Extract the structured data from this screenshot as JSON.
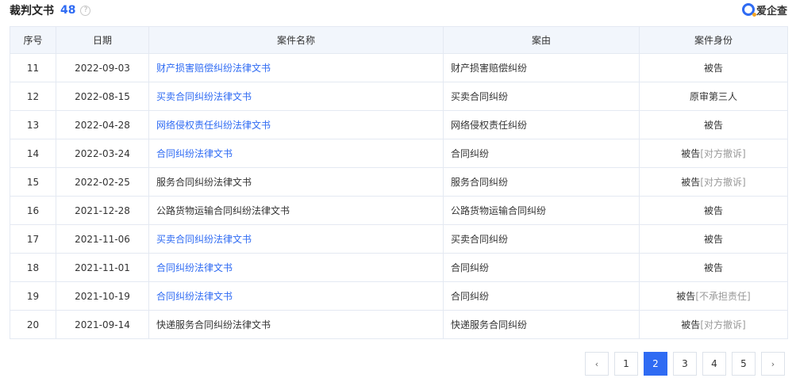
{
  "header": {
    "title": "裁判文书",
    "count": "48",
    "help": "?",
    "brand": "爱企查"
  },
  "table": {
    "columns": [
      "序号",
      "日期",
      "案件名称",
      "案由",
      "案件身份"
    ],
    "rows": [
      {
        "no": "11",
        "date": "2022-09-03",
        "name": "财产损害赔偿纠纷法律文书",
        "link": true,
        "cause": "财产损害赔偿纠纷",
        "role": "被告",
        "role_note": ""
      },
      {
        "no": "12",
        "date": "2022-08-15",
        "name": "买卖合同纠纷法律文书",
        "link": true,
        "cause": "买卖合同纠纷",
        "role": "原审第三人",
        "role_note": ""
      },
      {
        "no": "13",
        "date": "2022-04-28",
        "name": "网络侵权责任纠纷法律文书",
        "link": true,
        "cause": "网络侵权责任纠纷",
        "role": "被告",
        "role_note": ""
      },
      {
        "no": "14",
        "date": "2022-03-24",
        "name": "合同纠纷法律文书",
        "link": true,
        "cause": "合同纠纷",
        "role": "被告",
        "role_note": "[对方撤诉]"
      },
      {
        "no": "15",
        "date": "2022-02-25",
        "name": "服务合同纠纷法律文书",
        "link": false,
        "cause": "服务合同纠纷",
        "role": "被告",
        "role_note": "[对方撤诉]"
      },
      {
        "no": "16",
        "date": "2021-12-28",
        "name": "公路货物运输合同纠纷法律文书",
        "link": false,
        "cause": "公路货物运输合同纠纷",
        "role": "被告",
        "role_note": ""
      },
      {
        "no": "17",
        "date": "2021-11-06",
        "name": "买卖合同纠纷法律文书",
        "link": true,
        "cause": "买卖合同纠纷",
        "role": "被告",
        "role_note": ""
      },
      {
        "no": "18",
        "date": "2021-11-01",
        "name": "合同纠纷法律文书",
        "link": true,
        "cause": "合同纠纷",
        "role": "被告",
        "role_note": ""
      },
      {
        "no": "19",
        "date": "2021-10-19",
        "name": "合同纠纷法律文书",
        "link": true,
        "cause": "合同纠纷",
        "role": "被告",
        "role_note": "[不承担责任]"
      },
      {
        "no": "20",
        "date": "2021-09-14",
        "name": "快递服务合同纠纷法律文书",
        "link": false,
        "cause": "快递服务合同纠纷",
        "role": "被告",
        "role_note": "[对方撤诉]"
      }
    ]
  },
  "pagination": {
    "prev": "‹",
    "next": "›",
    "pages": [
      "1",
      "2",
      "3",
      "4",
      "5"
    ],
    "current": "2"
  },
  "colors": {
    "accent": "#2f6bf3",
    "header_bg": "#f2f6fc",
    "border": "#e4e9f2",
    "muted": "#999999"
  }
}
